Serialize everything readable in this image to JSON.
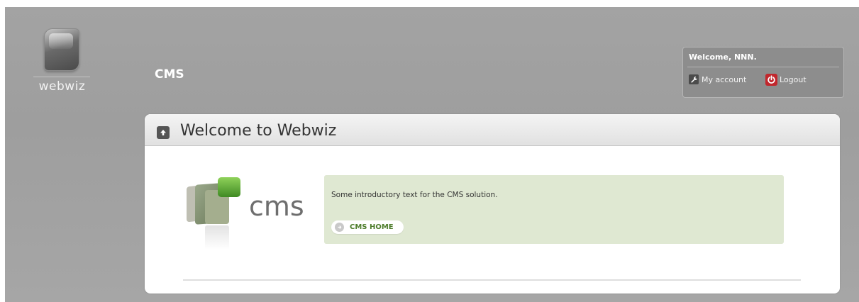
{
  "brand": {
    "logo_text": "webwiz"
  },
  "header": {
    "app_title": "CMS"
  },
  "user_menu": {
    "welcome": "Welcome, NNN.",
    "account_label": "My account",
    "logout_label": "Logout"
  },
  "panel": {
    "title": "Welcome to Webwiz",
    "logo_word": "cms",
    "intro": "Some introductory text for the CMS solution.",
    "home_button": "CMS HOME"
  },
  "colors": {
    "background": "#a3a3a3",
    "accent_green": "#4e7d2c",
    "info_box": "#dfe8d2",
    "logout_red": "#c1272d"
  },
  "icons": [
    "up-arrow-icon",
    "wrench-icon",
    "power-icon",
    "circle-arrow-icon"
  ]
}
